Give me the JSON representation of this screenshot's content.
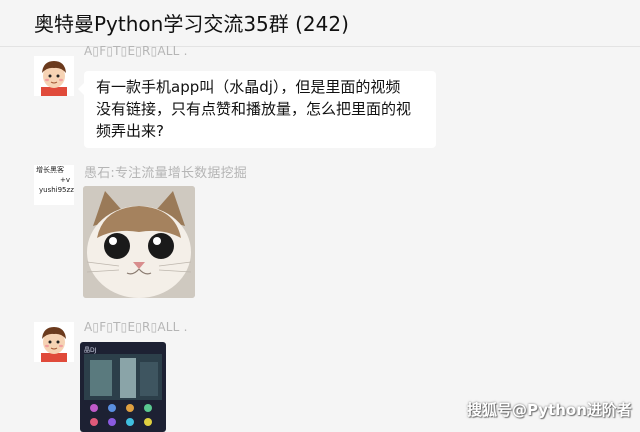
{
  "window": {
    "title": "奥特曼Python学习交流35群 (242)"
  },
  "messages": [
    {
      "sender": "A▯F▯T▯E▯R▯ALL .",
      "avatar": "cartoon-boy-avatar",
      "lines": [
        "有一款手机app叫（水晶dj），但是里面的视频",
        "没有链接，只有点赞和播放量，怎么把里面的视",
        "频弄出来?"
      ]
    },
    {
      "sender": "愚石:专注流量增长数据挖掘",
      "avatar_text": [
        "增长黑客",
        "+v",
        "yushi95zz"
      ],
      "image": "cat-face-sticker"
    },
    {
      "sender": "A▯F▯T▯E▯R▯ALL .",
      "avatar": "cartoon-boy-avatar",
      "image": "phone-app-screenshot",
      "image_status": "晶DJ"
    }
  ],
  "watermark": "搜狐号@Python进阶者",
  "colors": {
    "background": "#f5f5f5",
    "bubble": "#ffffff",
    "sender_name": "#b5b5b5"
  }
}
